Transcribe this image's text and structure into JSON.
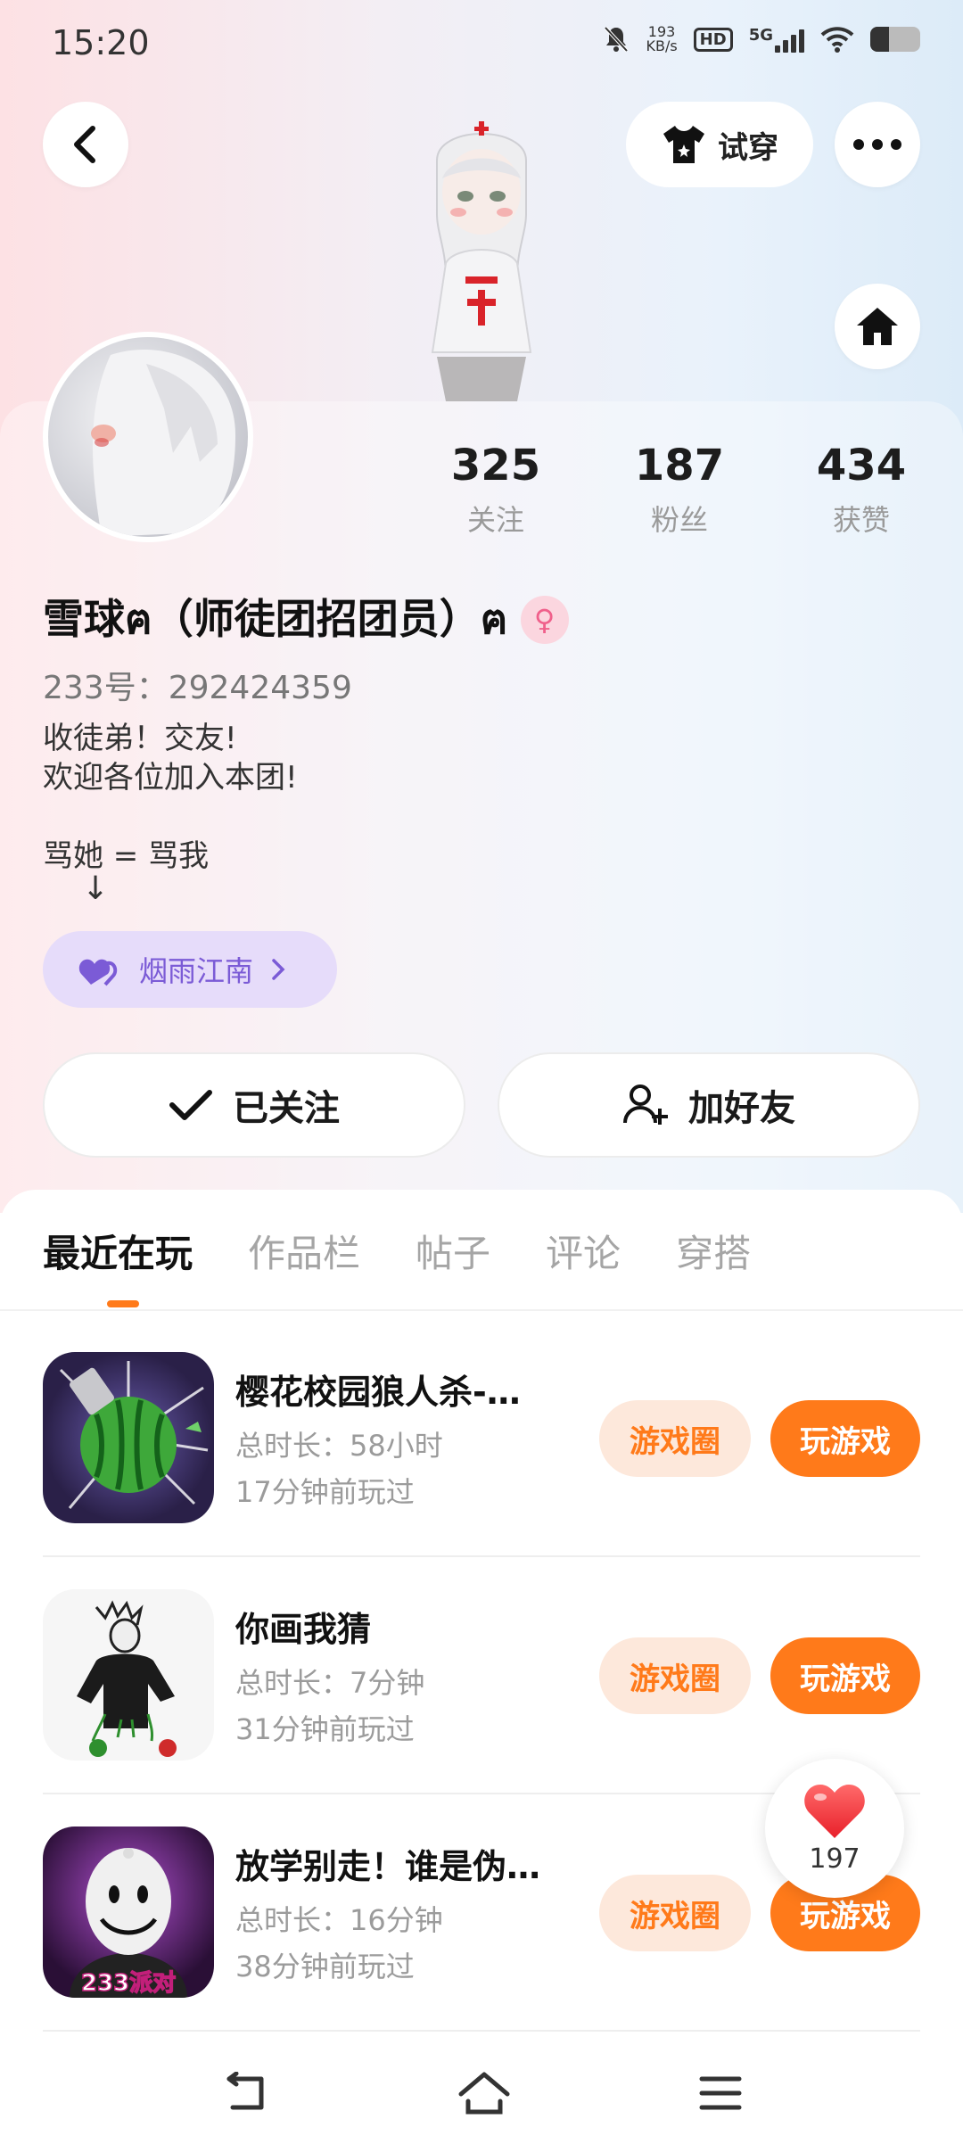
{
  "status_bar": {
    "time": "15:20",
    "net_speed_value": "193",
    "net_speed_unit": "KB/s",
    "hd": "HD",
    "network": "5G"
  },
  "header": {
    "try_on_label": "试穿"
  },
  "stats": [
    {
      "value": "325",
      "label": "关注"
    },
    {
      "value": "187",
      "label": "粉丝"
    },
    {
      "value": "434",
      "label": "获赞"
    }
  ],
  "profile": {
    "name": "雪球ฅ（师徒团招团员）ฅ",
    "gender_symbol": "♀",
    "uid": "233号：292424359",
    "bio": "收徒弟！交友!\n欢迎各位加入本团!\n\n骂她 = 骂我",
    "bio_arrow": "↓",
    "guild": "烟雨江南"
  },
  "actions": {
    "followed_label": "已关注",
    "add_friend_label": "加好友"
  },
  "tabs": [
    "最近在玩",
    "作品栏",
    "帖子",
    "评论",
    "穿搭"
  ],
  "games": [
    {
      "title": "樱花校园狼人杀-…",
      "duration": "总时长：58小时",
      "last_played": "17分钟前玩过",
      "circle_label": "游戏圈",
      "play_label": "玩游戏"
    },
    {
      "title": "你画我猜",
      "duration": "总时长：7分钟",
      "last_played": "31分钟前玩过",
      "circle_label": "游戏圈",
      "play_label": "玩游戏"
    },
    {
      "title": "放学别走！谁是伪…",
      "duration": "总时长：16分钟",
      "last_played": "38分钟前玩过",
      "circle_label": "游戏圈",
      "play_label": "玩游戏",
      "icon_badge": "233派对"
    }
  ],
  "like_count": "197",
  "colors": {
    "accent": "#ff7a1a",
    "guild_bg": "#e6dcfa",
    "guild_text": "#7b5bd6"
  }
}
